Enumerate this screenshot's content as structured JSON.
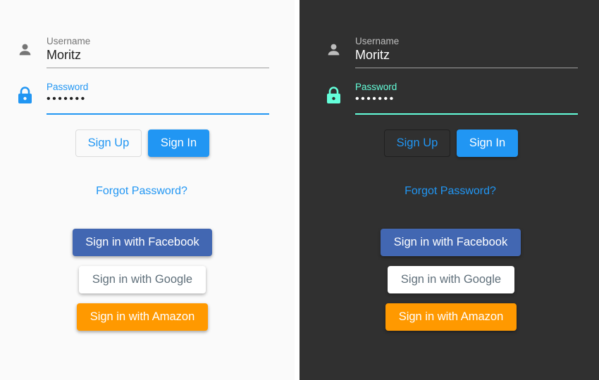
{
  "themes": {
    "light": {
      "username": {
        "label": "Username",
        "value": "Moritz"
      },
      "password": {
        "label": "Password",
        "value": "•••••••"
      },
      "sign_up": "Sign Up",
      "sign_in": "Sign In",
      "forgot_password": "Forgot Password?",
      "facebook": "Sign in with Facebook",
      "google": "Sign in with Google",
      "amazon": "Sign in with Amazon"
    },
    "dark": {
      "username": {
        "label": "Username",
        "value": "Moritz"
      },
      "password": {
        "label": "Password",
        "value": "•••••••"
      },
      "sign_up": "Sign Up",
      "sign_in": "Sign In",
      "forgot_password": "Forgot Password?",
      "facebook": "Sign in with Facebook",
      "google": "Sign in with Google",
      "amazon": "Sign in with Amazon"
    }
  },
  "colors": {
    "primary_light": "#2196f3",
    "accent_dark": "#64ffda",
    "facebook": "#4267b2",
    "amazon": "#ff9900",
    "dark_background": "#303030",
    "light_background": "#fafafa"
  },
  "icons": {
    "username": "person-icon",
    "password": "lock-icon"
  }
}
